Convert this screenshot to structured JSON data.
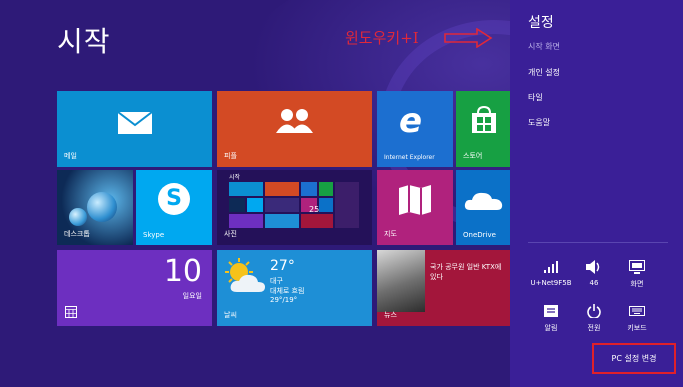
{
  "start": {
    "title": "시작"
  },
  "annotation": {
    "text": "윈도우키+I"
  },
  "tiles": {
    "mail": {
      "label": "메일",
      "color": "#0b8fd1"
    },
    "people": {
      "label": "피플",
      "color": "#d34a24"
    },
    "ie": {
      "label": "Internet Explorer",
      "color": "#1c6fd0"
    },
    "store": {
      "label": "스토어",
      "color": "#17a043"
    },
    "desktop": {
      "label": "데스크톱"
    },
    "skype": {
      "label": "Skype",
      "color": "#00a8f0"
    },
    "start_preview": {
      "label": "시작",
      "date": "25"
    },
    "photos": {
      "label": "사진"
    },
    "maps": {
      "label": "지도",
      "color": "#b0227d"
    },
    "onedrive": {
      "label": "OneDrive",
      "color": "#0b71c8"
    },
    "calendar": {
      "date": "10",
      "day": "일요일",
      "color": "#6d2fc0"
    },
    "weather": {
      "temp": "27°",
      "city": "대구",
      "condition": "대체로 흐림",
      "range": "29°/19°",
      "label": "날씨",
      "color": "#1e8fd6"
    },
    "news": {
      "headline": "국가 공무원 일반 KTX에 있다",
      "label": "뉴스",
      "color": "#a3163b"
    }
  },
  "panel": {
    "title": "설정",
    "subtitle": "시작 화면",
    "items": [
      "개인 설정",
      "타일",
      "도움말"
    ],
    "quick": [
      {
        "icon": "network-icon",
        "glyph": "▂▄▆",
        "label": "U+Net9F5B"
      },
      {
        "icon": "volume-icon",
        "glyph": "🔊",
        "label": "46"
      },
      {
        "icon": "screen-icon",
        "glyph": "▭",
        "label": "화면"
      },
      {
        "icon": "notifications-icon",
        "glyph": "▤",
        "label": "알림"
      },
      {
        "icon": "power-icon",
        "glyph": "⏻",
        "label": "전원"
      },
      {
        "icon": "keyboard-icon",
        "glyph": "⌨",
        "label": "키보드"
      }
    ],
    "pc_settings": "PC 설정 변경"
  }
}
